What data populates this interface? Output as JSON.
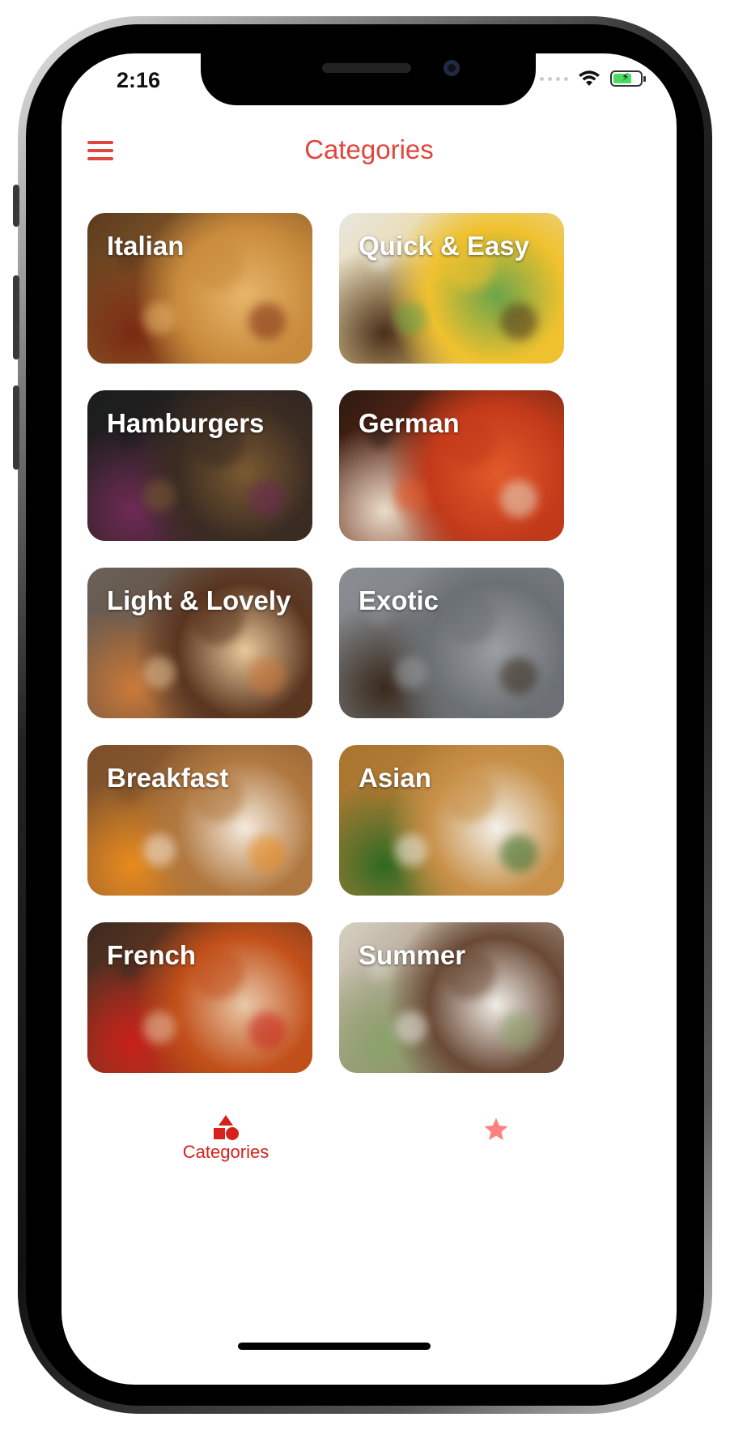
{
  "status_bar": {
    "time": "2:16",
    "battery_level": 0.7
  },
  "header": {
    "title": "Categories",
    "menu_icon": "hamburger-menu-icon"
  },
  "categories": [
    {
      "label": "Italian",
      "photo": "pizza",
      "colors": [
        "#5a3a1e",
        "#c98b3c",
        "#e7b56a",
        "#7a2a12"
      ]
    },
    {
      "label": "Quick & Easy",
      "photo": "rice-bowls",
      "colors": [
        "#e8e6e2",
        "#f0c12e",
        "#6aa54a",
        "#4a2f1c"
      ]
    },
    {
      "label": "Hamburgers",
      "photo": "burger",
      "colors": [
        "#1a1c1e",
        "#3b2c22",
        "#7a5a32",
        "#6e2a55"
      ]
    },
    {
      "label": "German",
      "photo": "sausages",
      "colors": [
        "#2a1a12",
        "#c23a1a",
        "#e25a2a",
        "#e8dcc8"
      ]
    },
    {
      "label": "Light & Lovely",
      "photo": "salad-bowl",
      "colors": [
        "#6a625a",
        "#5a3520",
        "#e8c89a",
        "#cc7a3a"
      ]
    },
    {
      "label": "Exotic",
      "photo": "noodles",
      "colors": [
        "#8a8e92",
        "#6b7074",
        "#9a9ea2",
        "#3a2a1e"
      ]
    },
    {
      "label": "Breakfast",
      "photo": "french-toast",
      "colors": [
        "#7a4e2a",
        "#b07840",
        "#f5eadc",
        "#e88a1e"
      ]
    },
    {
      "label": "Asian",
      "photo": "pho",
      "colors": [
        "#a8742e",
        "#c89048",
        "#f2f0ea",
        "#2f6a22"
      ]
    },
    {
      "label": "French",
      "photo": "stew",
      "colors": [
        "#3a2a22",
        "#c2501a",
        "#e8c8a8",
        "#c8201a"
      ]
    },
    {
      "label": "Summer",
      "photo": "picnic",
      "colors": [
        "#d8d2c4",
        "#6a4a36",
        "#f0ece6",
        "#8aa26a"
      ]
    }
  ],
  "tab_bar": {
    "categories": {
      "label": "Categories",
      "icon": "categories-shapes-icon",
      "active": true
    },
    "favorites": {
      "icon": "star-icon",
      "active": false
    }
  },
  "theme": {
    "accent": "#e0463d",
    "tab_active": "#d6221a",
    "tab_inactive": "#ff8080"
  }
}
